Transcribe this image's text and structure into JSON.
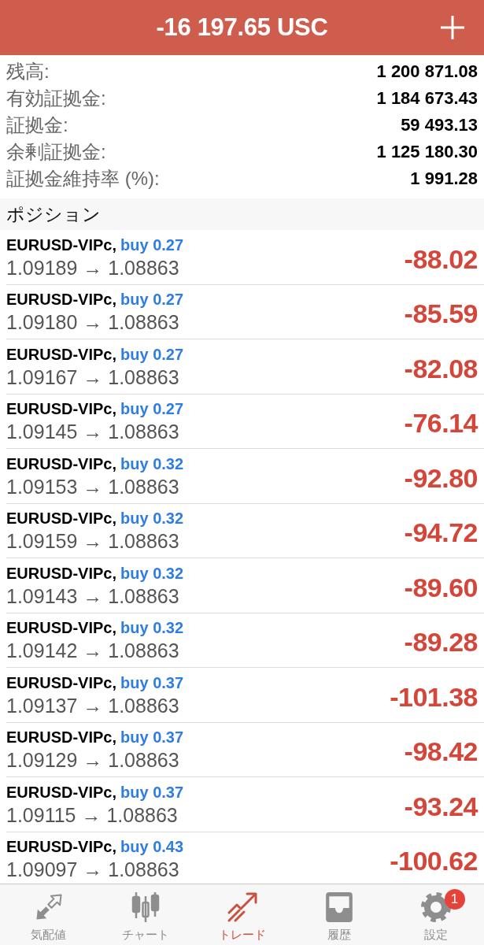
{
  "header": {
    "title": "-16 197.65 USC"
  },
  "summary": [
    {
      "label": "残高:",
      "value": "1 200 871.08"
    },
    {
      "label": "有効証拠金:",
      "value": "1 184 673.43"
    },
    {
      "label": "証拠金:",
      "value": "59 493.13"
    },
    {
      "label": "余剰証拠金:",
      "value": "1 125 180.30"
    },
    {
      "label": "証拠金維持率 (%):",
      "value": "1 991.28"
    }
  ],
  "positions": {
    "title": "ポジション",
    "rows": [
      {
        "symbol": "EURUSD-VIPc,",
        "order": "buy 0.27",
        "prices": "1.09189 → 1.08863",
        "profit": "-88.02"
      },
      {
        "symbol": "EURUSD-VIPc,",
        "order": "buy 0.27",
        "prices": "1.09180 → 1.08863",
        "profit": "-85.59"
      },
      {
        "symbol": "EURUSD-VIPc,",
        "order": "buy 0.27",
        "prices": "1.09167 → 1.08863",
        "profit": "-82.08"
      },
      {
        "symbol": "EURUSD-VIPc,",
        "order": "buy 0.27",
        "prices": "1.09145 → 1.08863",
        "profit": "-76.14"
      },
      {
        "symbol": "EURUSD-VIPc,",
        "order": "buy 0.32",
        "prices": "1.09153 → 1.08863",
        "profit": "-92.80"
      },
      {
        "symbol": "EURUSD-VIPc,",
        "order": "buy 0.32",
        "prices": "1.09159 → 1.08863",
        "profit": "-94.72"
      },
      {
        "symbol": "EURUSD-VIPc,",
        "order": "buy 0.32",
        "prices": "1.09143 → 1.08863",
        "profit": "-89.60"
      },
      {
        "symbol": "EURUSD-VIPc,",
        "order": "buy 0.32",
        "prices": "1.09142 → 1.08863",
        "profit": "-89.28"
      },
      {
        "symbol": "EURUSD-VIPc,",
        "order": "buy 0.37",
        "prices": "1.09137 → 1.08863",
        "profit": "-101.38"
      },
      {
        "symbol": "EURUSD-VIPc,",
        "order": "buy 0.37",
        "prices": "1.09129 → 1.08863",
        "profit": "-98.42"
      },
      {
        "symbol": "EURUSD-VIPc,",
        "order": "buy 0.37",
        "prices": "1.09115 → 1.08863",
        "profit": "-93.24"
      },
      {
        "symbol": "EURUSD-VIPc,",
        "order": "buy 0.43",
        "prices": "1.09097 → 1.08863",
        "profit": "-100.62"
      }
    ]
  },
  "tabs": [
    {
      "kind": "quotes",
      "label": "気配値",
      "selected": false
    },
    {
      "kind": "chart",
      "label": "チャート",
      "selected": false
    },
    {
      "kind": "trade",
      "label": "トレード",
      "selected": true
    },
    {
      "kind": "history",
      "label": "履歴",
      "selected": false
    },
    {
      "kind": "settings",
      "label": "設定",
      "selected": false,
      "badge": "1"
    }
  ]
}
